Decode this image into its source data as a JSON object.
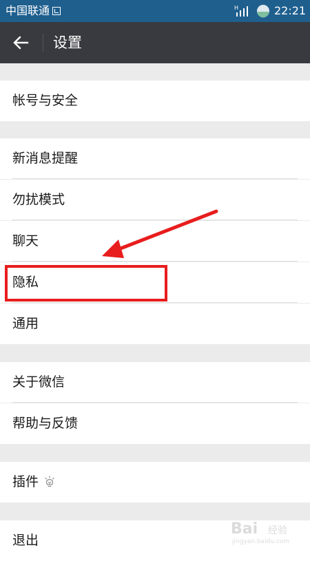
{
  "status_bar": {
    "carrier": "中国联通",
    "time": "22:21",
    "background": "#1f5f8e",
    "icons": [
      "image-box-icon",
      "signal-icon",
      "battery-icon"
    ]
  },
  "toolbar": {
    "title": "设置",
    "background": "#393a3f",
    "back_icon": "arrow-left-icon"
  },
  "settings": {
    "groups": [
      {
        "items": [
          {
            "label": "帐号与安全"
          }
        ]
      },
      {
        "items": [
          {
            "label": "新消息提醒"
          },
          {
            "label": "勿扰模式"
          },
          {
            "label": "聊天"
          },
          {
            "label": "隐私"
          },
          {
            "label": "通用"
          }
        ]
      },
      {
        "items": [
          {
            "label": "关于微信"
          },
          {
            "label": "帮助与反馈"
          }
        ]
      },
      {
        "items": [
          {
            "label": "插件",
            "icon": "lightbulb-icon"
          }
        ]
      },
      {
        "items": [
          {
            "label": "退出"
          }
        ]
      }
    ]
  },
  "annotation": {
    "highlighted_item": "隐私",
    "color": "#e81d1d"
  },
  "watermark": {
    "text": "Bai",
    "sub": "经验",
    "url": "jingyan.baidu.com"
  }
}
